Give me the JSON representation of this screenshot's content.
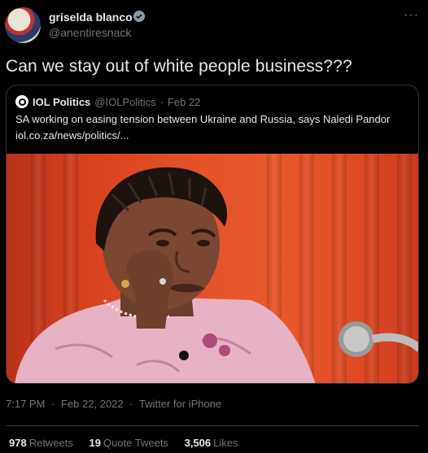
{
  "author": {
    "name": "griselda blanco",
    "handle": "@anentiresnack"
  },
  "tweet": {
    "text": "Can we stay out of white people business???"
  },
  "quoted": {
    "name": "IOL Politics",
    "handle": "@IOLPolitics",
    "separator": "·",
    "date": "Feb 22",
    "title": "SA working on easing tension between Ukraine and Russia, says Naledi Pandor",
    "link": "iol.co.za/news/politics/..."
  },
  "meta": {
    "time": "7:17 PM",
    "separator": "·",
    "date": "Feb 22, 2022",
    "source": "Twitter for iPhone"
  },
  "stats": {
    "retweets_count": "978",
    "retweets_label": "Retweets",
    "quotes_count": "19",
    "quotes_label": "Quote Tweets",
    "likes_count": "3,506",
    "likes_label": "Likes"
  },
  "icons": {
    "more": "more-icon",
    "verified": "verified-icon"
  }
}
